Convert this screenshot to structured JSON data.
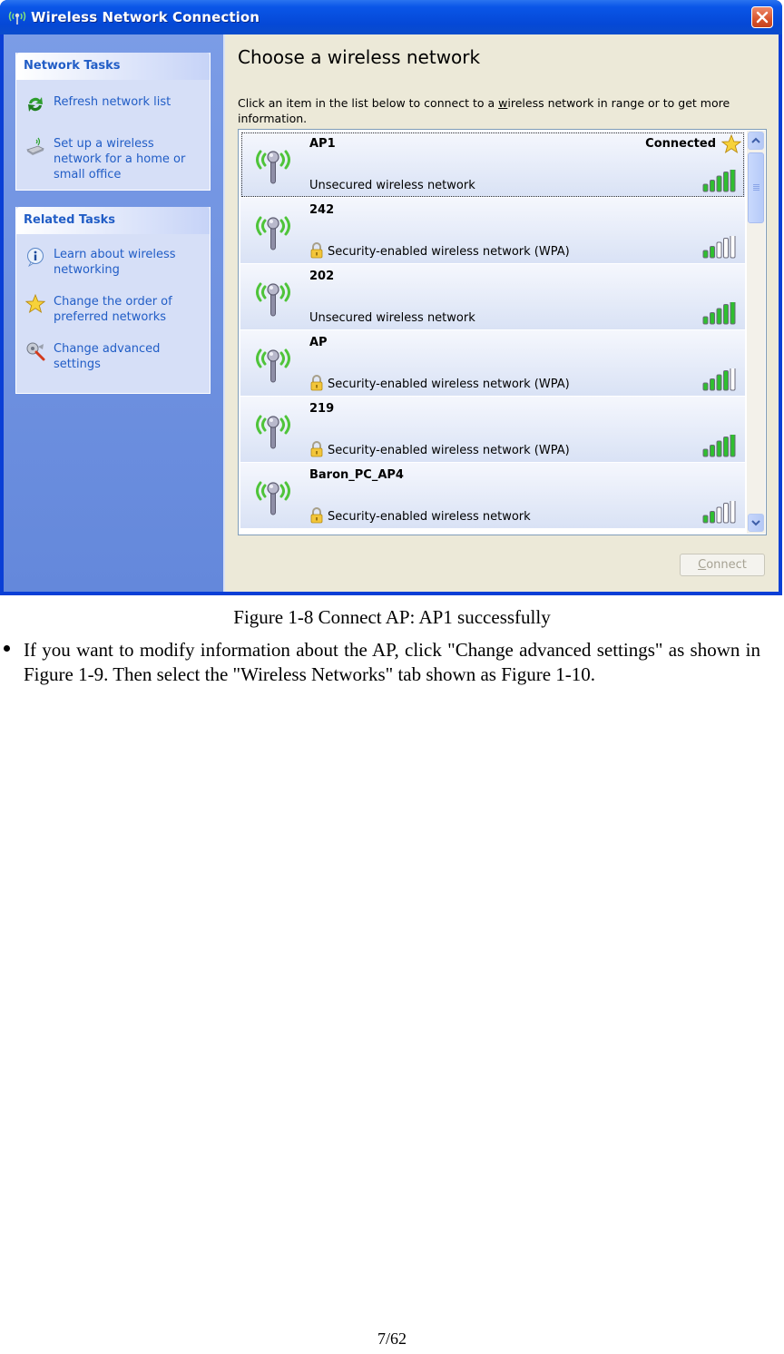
{
  "window": {
    "title": "Wireless Network Connection",
    "close_label": "Close"
  },
  "sidebar": {
    "network_tasks": {
      "header": "Network Tasks",
      "items": [
        {
          "label": "Refresh network list",
          "icon": "refresh-icon"
        },
        {
          "label": "Set up a wireless network for a home or small office",
          "icon": "wireless-setup-icon"
        }
      ]
    },
    "related_tasks": {
      "header": "Related Tasks",
      "items": [
        {
          "label": "Learn about wireless networking",
          "icon": "info-icon"
        },
        {
          "label": "Change the order of preferred networks",
          "icon": "star-icon"
        },
        {
          "label": "Change advanced settings",
          "icon": "settings-wrench-icon"
        }
      ]
    }
  },
  "main": {
    "title": "Choose a wireless network",
    "instructions_pre": "Click an item in the list below to connect to a ",
    "instructions_accel": "w",
    "instructions_post": "ireless network in range or to get more information.",
    "networks": [
      {
        "ssid": "AP1",
        "security": "Unsecured wireless network",
        "secured": false,
        "status": "Connected",
        "preferred": true,
        "signal_bars": 5,
        "selected": true
      },
      {
        "ssid": "242",
        "security": "Security-enabled wireless network (WPA)",
        "secured": true,
        "status": "",
        "preferred": false,
        "signal_bars": 2,
        "selected": false
      },
      {
        "ssid": "202",
        "security": "Unsecured wireless network",
        "secured": false,
        "status": "",
        "preferred": false,
        "signal_bars": 5,
        "selected": false
      },
      {
        "ssid": "AP",
        "security": "Security-enabled wireless network (WPA)",
        "secured": true,
        "status": "",
        "preferred": false,
        "signal_bars": 4,
        "selected": false
      },
      {
        "ssid": "219",
        "security": "Security-enabled wireless network (WPA)",
        "secured": true,
        "status": "",
        "preferred": false,
        "signal_bars": 5,
        "selected": false
      },
      {
        "ssid": "Baron_PC_AP4",
        "security": "Security-enabled wireless network",
        "secured": true,
        "status": "",
        "preferred": false,
        "signal_bars": 2,
        "selected": false
      }
    ],
    "signal_bars_max": 5,
    "connect_accel": "C",
    "connect_rest": "onnect",
    "connect_enabled": false
  },
  "document": {
    "caption": "Figure 1-8 Connect AP: AP1 successfully",
    "bullet_text": "If you want to modify information about the AP, click \"Change advanced settings\" as shown in Figure 1-9. Then select the \"Wireless Networks\" tab shown as Figure 1-10.",
    "page_number": "7/62"
  },
  "colors": {
    "titlebar": "#0548d6",
    "sidebar": "#6f8fe0",
    "link": "#215dc6",
    "signal_on": "#2fbf2f",
    "signal_off": "#ffffff",
    "close_button": "#d8542c"
  }
}
